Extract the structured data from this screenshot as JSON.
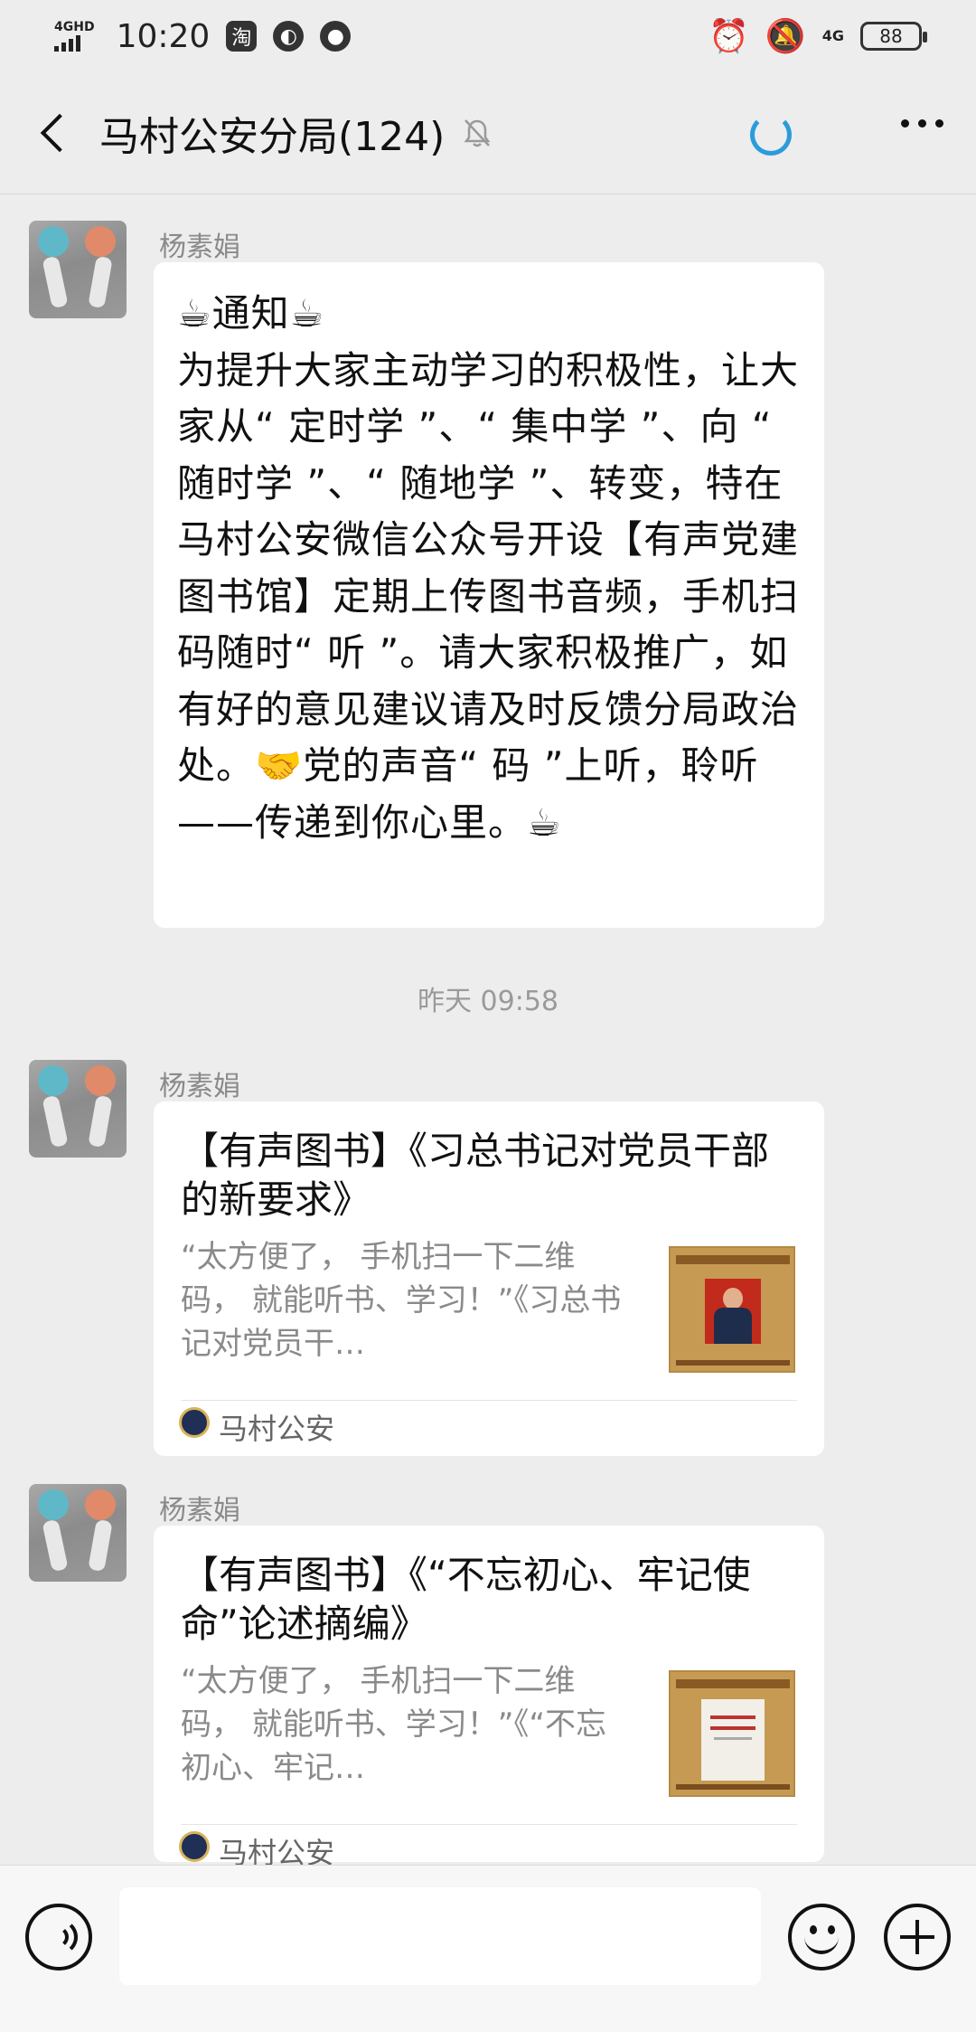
{
  "status_bar": {
    "network": "4GHD",
    "time": "10:20",
    "app_icon_1": "淘",
    "net2": "4G",
    "battery": "88"
  },
  "header": {
    "title": "马村公安分局(124)"
  },
  "messages": [
    {
      "sender": "杨素娟",
      "notice_heading": "通知",
      "notice_body": "为提升大家主动学习的积极性，让大家从“ 定时学 ”、“ 集中学 ”、向 “ 随时学 ”、“ 随地学 ”、转变，特在马村公安微信公众号开设【有声党建图书馆】定期上传图书音频，手机扫码随时“ 听 ”。请大家积极推广，如有好的意见建议请及时反馈分局政治处。",
      "notice_tail": "党的声音“ 码 ”上听，聆听——传递到你心里。"
    }
  ],
  "time_separator": "昨天 09:58",
  "cards": [
    {
      "sender": "杨素娟",
      "title": "【有声图书】《习总书记对党员干部的新要求》",
      "desc": "“太方便了，  手机扫一下二维码，    就能听书、学习！”《习总书记对党员干…",
      "source": "马村公安"
    },
    {
      "sender": "杨素娟",
      "title": "【有声图书】《“不忘初心、牢记使命”论述摘编》",
      "desc": "“太方便了，  手机扫一下二维码，    就能听书、学习！”《“不忘初心、牢记…",
      "source": "马村公安"
    }
  ],
  "input": {
    "placeholder": ""
  },
  "icons": {
    "back": "chevron-left-icon",
    "mute": "bell-muted-icon",
    "loading": "loading-spinner-icon",
    "more": "more-dots-icon",
    "voice": "voice-icon",
    "emoji": "emoji-icon",
    "plus": "plus-icon",
    "cup": "☕",
    "handshake": "🤝"
  },
  "colors": {
    "background": "#ededed",
    "bubble": "#ffffff",
    "spinner": "#2b9cdb",
    "muted_text": "#8a8a8a"
  }
}
